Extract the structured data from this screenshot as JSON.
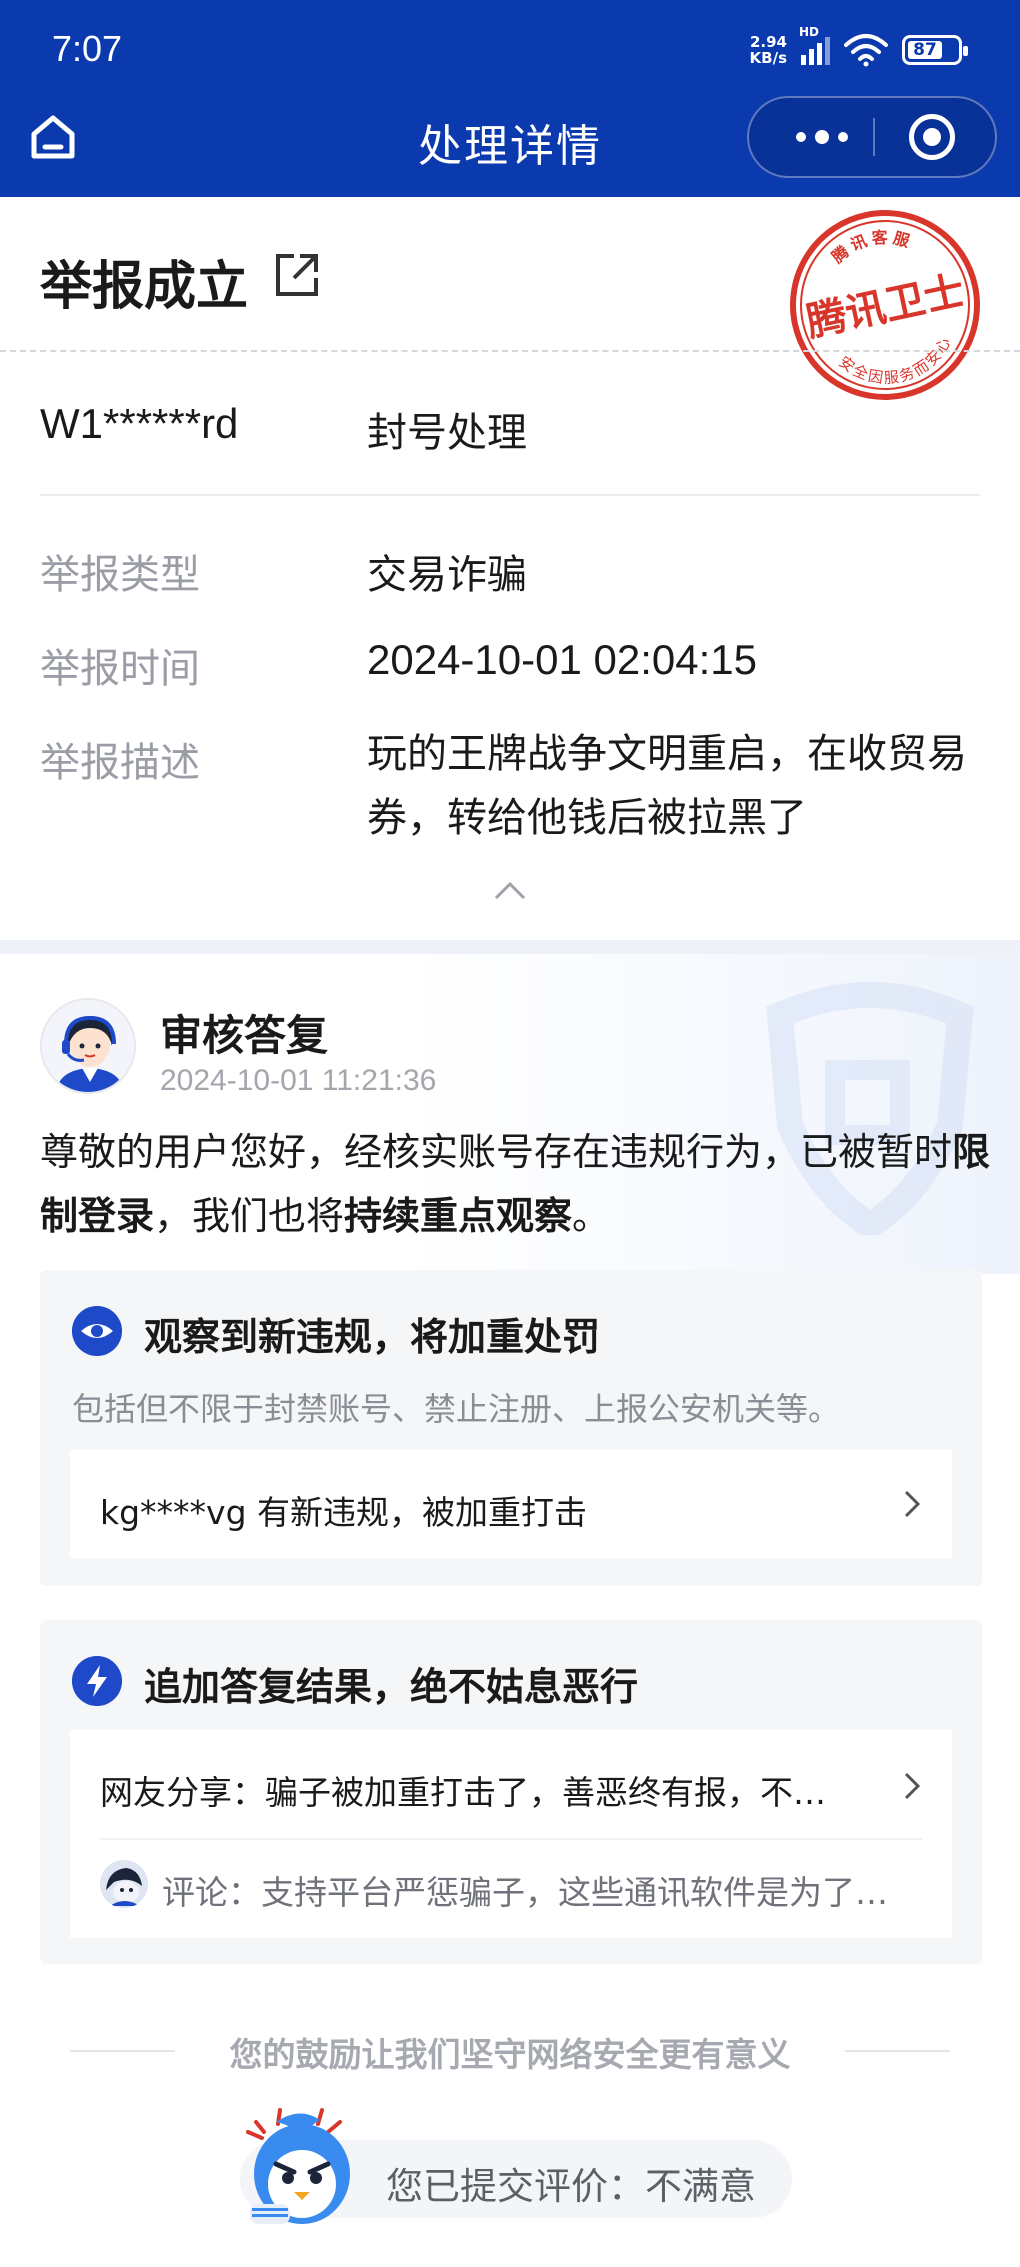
{
  "status_bar": {
    "time": "7:07",
    "net_speed_value": "2.94",
    "net_speed_unit": "KB/s",
    "network_tag": "HD",
    "battery": "87"
  },
  "nav": {
    "title": "处理详情"
  },
  "result": {
    "title": "举报成立",
    "stamp_text_main": "腾讯卫士",
    "stamp_text_top": "腾讯客服",
    "stamp_text_bottom": "安全因服务而安心",
    "account": "W1******rd",
    "action": "封号处理"
  },
  "details": [
    {
      "label": "举报类型",
      "value": "交易诈骗"
    },
    {
      "label": "举报时间",
      "value": "2024-10-01 02:04:15"
    },
    {
      "label": "举报描述",
      "value": "玩的王牌战争文明重启，在收贸易券，转给他钱后被拉黑了"
    }
  ],
  "reply": {
    "title": "审核答复",
    "time": "2024-10-01 11:21:36",
    "text_part1": "尊敬的用户您好，经核实账号存在违规行为，已被暂时",
    "text_bold1": "限制登录",
    "text_part2": "，我们也将",
    "text_bold2": "持续重点观察",
    "text_part3": "。"
  },
  "card_observe": {
    "title": "观察到新违规，将加重处罚",
    "subtitle": "包括但不限于封禁账号、禁止注册、上报公安机关等。",
    "item": "kg****vg 有新违规，被加重打击"
  },
  "card_followup": {
    "title": "追加答复结果，绝不姑息恶行",
    "item": "网友分享：骗子被加重打击了，善恶终有报，不…",
    "comment": "评论：支持平台严惩骗子，这些通讯软件是为了…"
  },
  "footer": {
    "encouragement": "您的鼓励让我们坚守网络安全更有意义",
    "rated": "您已提交评价：不满意"
  },
  "colors": {
    "brand_blue": "#0b3aaf",
    "accent_blue": "#1e49c9",
    "stamp_red": "#d9362b"
  }
}
